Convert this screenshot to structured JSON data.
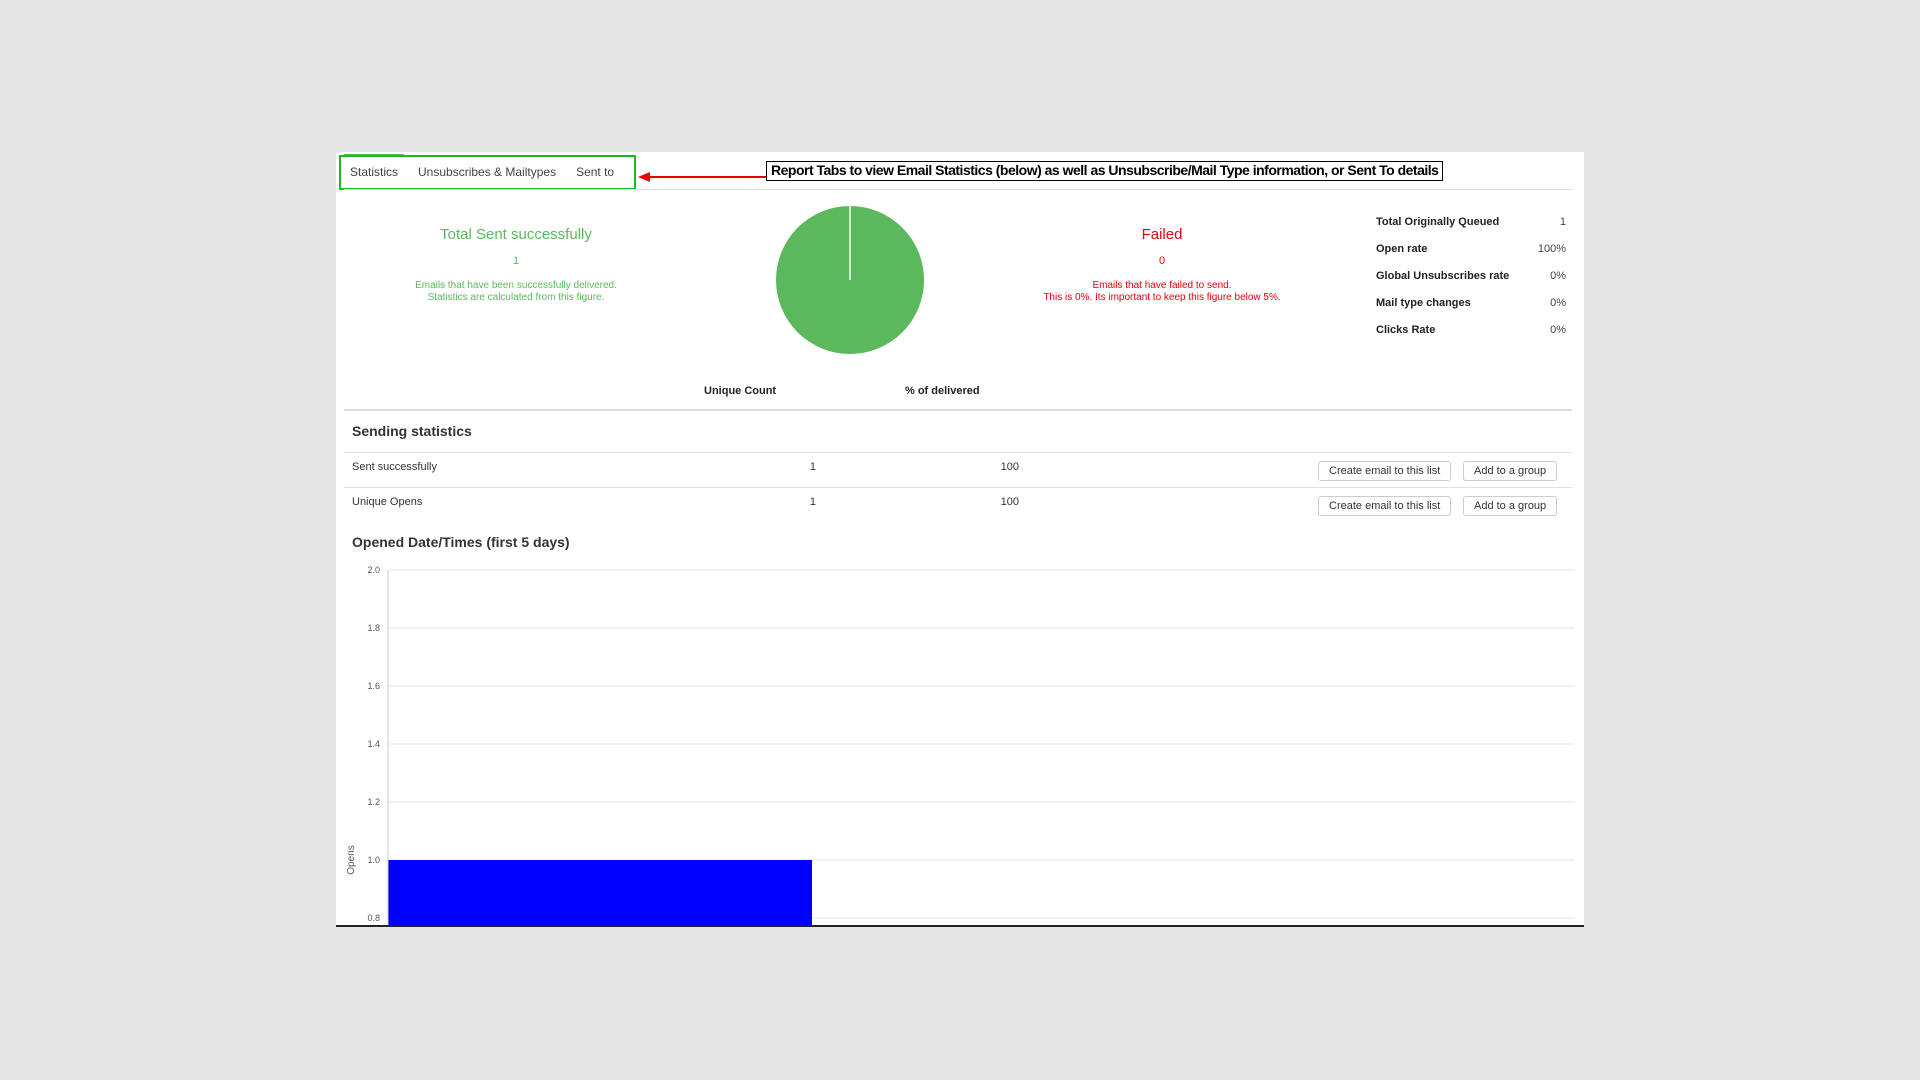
{
  "tabs": [
    {
      "label": "Statistics",
      "active": true
    },
    {
      "label": "Unsubscribes & Mailtypes",
      "active": false
    },
    {
      "label": "Sent to",
      "active": false
    }
  ],
  "annotation": {
    "text": "Report Tabs to view Email Statistics (below) as well as Unsubscribe/Mail Type information, or Sent To details",
    "color": "#e8000b"
  },
  "summary": {
    "success": {
      "title": "Total Sent successfully",
      "count": "1",
      "desc_line1": "Emails that have been successfully delivered.",
      "desc_line2": "Statistics are calculated from this figure.",
      "color": "#5cb85c"
    },
    "failed": {
      "title": "Failed",
      "count": "0",
      "desc_line1": "Emails that have failed to send.",
      "desc_line2": "This is 0%. Its important to keep this figure below 5%.",
      "color": "#e8000b"
    },
    "pie": {
      "sent": 1,
      "failed": 0,
      "color": "#5cb85c"
    }
  },
  "stats": [
    {
      "label": "Total Originally Queued",
      "value": "1"
    },
    {
      "label": "Open rate",
      "value": "100%"
    },
    {
      "label": "Global Unsubscribes rate",
      "value": "0%"
    },
    {
      "label": "Mail type changes",
      "value": "0%"
    },
    {
      "label": "Clicks Rate",
      "value": "0%"
    }
  ],
  "table": {
    "col_unique": "Unique Count",
    "col_percent": "% of delivered",
    "section_title": "Sending statistics",
    "rows": [
      {
        "label": "Sent successfully",
        "count": "1",
        "percent": "100",
        "btn_create": "Create email to this list",
        "btn_group": "Add to a group"
      },
      {
        "label": "Unique Opens",
        "count": "1",
        "percent": "100",
        "btn_create": "Create email to this list",
        "btn_group": "Add to a group"
      }
    ]
  },
  "chart_title": "Opened Date/Times (first 5 days)",
  "chart_data": {
    "type": "bar",
    "ylabel": "Opens",
    "ylim": [
      0.8,
      2.0
    ],
    "yticks": [
      "2.0",
      "1.8",
      "1.6",
      "1.4",
      "1.2",
      "1.0",
      "0.8"
    ],
    "values": [
      1
    ],
    "color": "#0000ff",
    "grid": true
  }
}
